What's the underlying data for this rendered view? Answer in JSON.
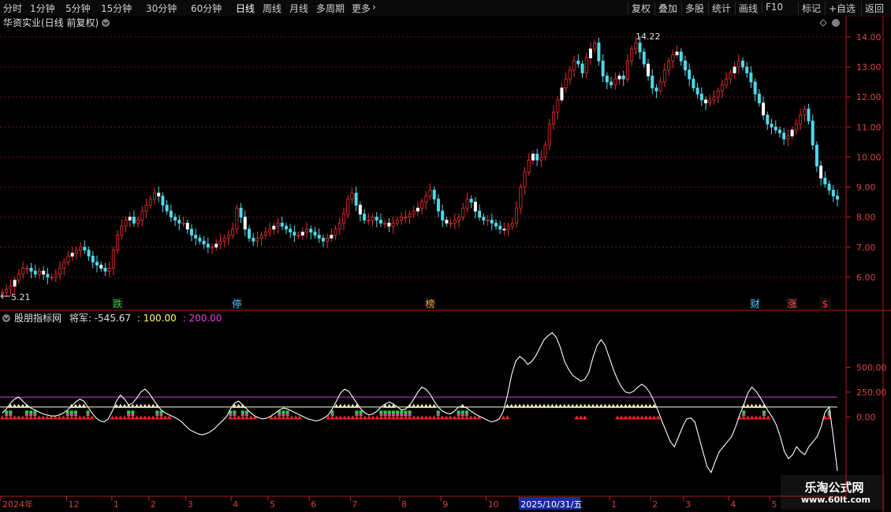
{
  "toolbar": {
    "left_items": [
      "分时",
      "1分钟",
      "5分钟",
      "15分钟",
      "30分钟",
      "60分钟",
      "日线",
      "周线",
      "月线",
      "多周期",
      "更多"
    ],
    "active": "日线",
    "right_items": [
      "复权",
      "叠加",
      "多股",
      "统计",
      "画线",
      "F10",
      "标记",
      "+自选",
      "返回"
    ]
  },
  "price_panel": {
    "title": "华资实业(日线 前复权)",
    "high_label": "14.22",
    "low_label": "5.21",
    "markers": [
      {
        "text": "跌",
        "x_index": 28,
        "color": "#2fd02f"
      },
      {
        "text": "停",
        "x_index": 57,
        "color": "#40c8ff"
      },
      {
        "text": "榜",
        "x_index": 104,
        "color": "#e0a040"
      },
      {
        "text": "财",
        "x_index": 183,
        "color": "#40c8ff"
      },
      {
        "text": "涨",
        "x_index": 192,
        "color": "#ff5050"
      },
      {
        "text": "$",
        "x_index": 200,
        "color": "#ff3030"
      }
    ]
  },
  "indicator_panel": {
    "name": "股朋指标网",
    "label": "将军:",
    "value1": "-545.67",
    "value2": "100.00",
    "value3": "200.00"
  },
  "time_axis": {
    "labels": [
      {
        "text": "2024年",
        "i": 0
      },
      {
        "text": "12",
        "i": 16
      },
      {
        "text": "1",
        "i": 27
      },
      {
        "text": "2",
        "i": 36
      },
      {
        "text": "3",
        "i": 45
      },
      {
        "text": "4",
        "i": 56
      },
      {
        "text": "5",
        "i": 65
      },
      {
        "text": "6",
        "i": 75
      },
      {
        "text": "7",
        "i": 85
      },
      {
        "text": "8",
        "i": 97
      },
      {
        "text": "9",
        "i": 107
      },
      {
        "text": "10",
        "i": 118
      },
      {
        "text": "2025/10/31/五",
        "i": 126,
        "highlight": true
      },
      {
        "text": "1",
        "i": 148
      },
      {
        "text": "2",
        "i": 158
      },
      {
        "text": "3",
        "i": 166
      },
      {
        "text": "4",
        "i": 177
      },
      {
        "text": "5",
        "i": 187
      }
    ]
  },
  "watermark": {
    "line1": "乐淘公式网",
    "line2": "www.60lt.com"
  },
  "chart_data": [
    {
      "type": "candlestick",
      "ylim": [
        5.0,
        14.6
      ],
      "yticks": [
        6.0,
        7.0,
        8.0,
        9.0,
        10.0,
        11.0,
        12.0,
        13.0,
        14.0
      ],
      "close_series": [
        5.5,
        5.6,
        5.7,
        5.9,
        6.1,
        6.3,
        6.3,
        6.2,
        6.1,
        6.2,
        6.1,
        6.0,
        6.0,
        6.1,
        6.3,
        6.5,
        6.7,
        6.8,
        6.9,
        7.0,
        6.9,
        6.7,
        6.5,
        6.4,
        6.3,
        6.2,
        6.3,
        6.9,
        7.4,
        7.7,
        7.9,
        8.0,
        7.8,
        7.9,
        8.2,
        8.4,
        8.6,
        8.8,
        8.7,
        8.4,
        8.2,
        8.0,
        7.9,
        7.8,
        7.8,
        7.6,
        7.4,
        7.3,
        7.2,
        7.1,
        7.0,
        7.0,
        7.1,
        7.2,
        7.3,
        7.4,
        7.6,
        8.3,
        8.0,
        7.6,
        7.3,
        7.2,
        7.3,
        7.4,
        7.5,
        7.6,
        7.7,
        7.8,
        7.7,
        7.6,
        7.5,
        7.4,
        7.4,
        7.5,
        7.6,
        7.5,
        7.4,
        7.3,
        7.2,
        7.3,
        7.4,
        7.6,
        7.8,
        8.1,
        8.6,
        8.8,
        8.4,
        8.1,
        7.9,
        7.9,
        8.0,
        7.9,
        7.8,
        7.8,
        7.7,
        7.8,
        7.9,
        8.0,
        8.0,
        8.1,
        8.2,
        8.3,
        8.5,
        8.7,
        8.9,
        8.6,
        8.2,
        7.9,
        7.8,
        7.8,
        7.9,
        8.0,
        8.3,
        8.6,
        8.5,
        8.2,
        8.0,
        7.9,
        7.9,
        7.8,
        7.7,
        7.6,
        7.6,
        7.7,
        7.8,
        8.3,
        9.0,
        9.5,
        9.9,
        10.1,
        9.9,
        10.0,
        10.4,
        11.1,
        11.5,
        11.9,
        12.3,
        12.6,
        12.9,
        13.2,
        13.1,
        12.8,
        13.3,
        13.6,
        13.8,
        13.2,
        12.7,
        12.5,
        12.4,
        12.6,
        12.7,
        12.6,
        13.2,
        13.6,
        13.8,
        13.5,
        13.1,
        12.7,
        12.3,
        12.2,
        12.5,
        12.9,
        13.2,
        13.4,
        13.5,
        13.2,
        12.9,
        12.6,
        12.3,
        12.1,
        11.9,
        11.8,
        11.9,
        12.0,
        12.2,
        12.4,
        12.6,
        12.8,
        13.0,
        13.2,
        13.0,
        12.8,
        12.5,
        12.1,
        11.8,
        11.4,
        11.1,
        11.0,
        10.9,
        10.8,
        10.6,
        10.7,
        10.9,
        11.1,
        11.4,
        11.6,
        11.2,
        10.4,
        9.7,
        9.3,
        9.1,
        8.9,
        8.7,
        8.6
      ]
    },
    {
      "type": "line",
      "name": "将军",
      "ylim": [
        -760,
        900
      ],
      "yticks": [
        0,
        250,
        500
      ],
      "hlines": [
        {
          "y": 100,
          "color": "#ffffe0"
        },
        {
          "y": 200,
          "color": "#d040d0"
        }
      ],
      "values": [
        40,
        80,
        140,
        180,
        200,
        160,
        120,
        90,
        70,
        50,
        30,
        20,
        10,
        10,
        20,
        40,
        70,
        110,
        150,
        180,
        160,
        100,
        40,
        -10,
        -40,
        -50,
        -20,
        60,
        160,
        220,
        180,
        120,
        140,
        190,
        250,
        280,
        240,
        180,
        120,
        70,
        40,
        20,
        0,
        -20,
        -50,
        -90,
        -130,
        -150,
        -170,
        -180,
        -170,
        -150,
        -120,
        -80,
        -40,
        0,
        80,
        140,
        160,
        120,
        80,
        40,
        10,
        -10,
        -20,
        -10,
        10,
        40,
        70,
        90,
        80,
        60,
        40,
        20,
        0,
        -20,
        -30,
        -40,
        -30,
        -10,
        20,
        80,
        160,
        240,
        280,
        260,
        200,
        140,
        80,
        40,
        20,
        30,
        60,
        100,
        130,
        150,
        130,
        100,
        70,
        80,
        120,
        180,
        250,
        300,
        280,
        230,
        160,
        100,
        60,
        40,
        30,
        60,
        100,
        110,
        90,
        60,
        30,
        10,
        -10,
        -30,
        -50,
        -40,
        -20,
        60,
        220,
        420,
        560,
        610,
        580,
        530,
        560,
        620,
        700,
        780,
        820,
        850,
        800,
        700,
        560,
        480,
        420,
        390,
        360,
        380,
        450,
        600,
        720,
        780,
        720,
        600,
        480,
        380,
        300,
        250,
        240,
        260,
        300,
        330,
        300,
        240,
        160,
        60,
        -50,
        -150,
        -250,
        -300,
        -200,
        -100,
        -20,
        -10,
        -50,
        -200,
        -350,
        -500,
        -560,
        -450,
        -350,
        -300,
        -250,
        -200,
        -100,
        20,
        120,
        240,
        300,
        260,
        200,
        130,
        60,
        0,
        -80,
        -200,
        -350,
        -420,
        -380,
        -300,
        -350,
        -380,
        -300,
        -250,
        -200,
        -100,
        50,
        100,
        -200,
        -545
      ]
    }
  ]
}
